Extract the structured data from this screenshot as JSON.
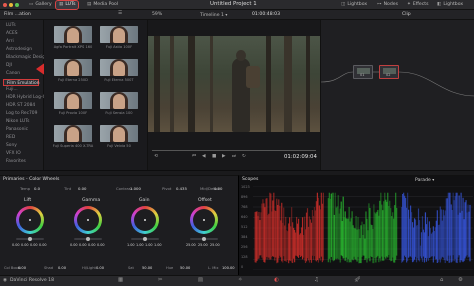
{
  "topbar": {
    "tabs": [
      {
        "label": "Gallery",
        "icon": "gallery-icon"
      },
      {
        "label": "LUTs",
        "icon": "luts-icon",
        "active": true
      },
      {
        "label": "Media Pool",
        "icon": "media-pool-icon"
      }
    ],
    "project_title": "Untitled Project 1",
    "right_tabs": [
      {
        "label": "Lightbox",
        "icon": "lightbox-icon"
      },
      {
        "label": "Nodes",
        "icon": "nodes-icon"
      },
      {
        "label": "Effects",
        "icon": "effects-icon"
      },
      {
        "label": "Lightbox",
        "icon": "lightbox-icon"
      }
    ]
  },
  "bar2": {
    "breadcrumb": "Film ...ation",
    "zoom": "59%",
    "timeline": "Timeline 1",
    "timecode": "01:00:48:03",
    "clip_label": "Clip"
  },
  "lut_tree": {
    "items": [
      "LUTs",
      "ACES",
      "Arri",
      "Astrodesign",
      "Blackmagic Design",
      "DJI",
      "Canon",
      "Film Emulation",
      "Fuji...",
      "HDR Hybrid Log-Gamma",
      "HDR ST 2084",
      "Log to Rec709",
      "Nikon LUTs",
      "Panasonic",
      "RED",
      "Sony",
      "VFX IO",
      "Favorites"
    ],
    "selected_index": 7
  },
  "lut_thumbs": [
    {
      "label": "Agfa Portrait XPS 160"
    },
    {
      "label": "Fuji Astia 100F"
    },
    {
      "label": "Fuji Eterna 250D"
    },
    {
      "label": "Fuji Eterna 500T"
    },
    {
      "label": "Fuji Provia 100F"
    },
    {
      "label": "Fuji Sensia 100"
    },
    {
      "label": "Fuji Superia 400 X-TRA"
    },
    {
      "label": "Fuji Velvia 50"
    }
  ],
  "viewer": {
    "timecode": "01:02:09:04"
  },
  "nodes": {
    "node_labels": [
      "01",
      "02"
    ]
  },
  "color_panel": {
    "title": "Primaries - Color Wheels",
    "top_params": [
      {
        "label": "Temp",
        "value": "0.0"
      },
      {
        "label": "Tint",
        "value": "0.00"
      },
      {
        "label": "Contrast",
        "value": "1.000"
      },
      {
        "label": "Pivot",
        "value": "0.435"
      },
      {
        "label": "Mid/Detail",
        "value": "0.00"
      }
    ],
    "wheels": [
      {
        "name": "Lift",
        "values": [
          "0.00",
          "0.00",
          "0.00",
          "0.00"
        ]
      },
      {
        "name": "Gamma",
        "values": [
          "0.00",
          "0.00",
          "0.00",
          "0.00"
        ]
      },
      {
        "name": "Gain",
        "values": [
          "1.00",
          "1.00",
          "1.00",
          "1.00"
        ]
      },
      {
        "name": "Offset",
        "values": [
          "25.00",
          "25.00",
          "25.00"
        ]
      }
    ],
    "bottom_params": [
      {
        "label": "Col Boost",
        "value": "0.00"
      },
      {
        "label": "Shad",
        "value": "0.00"
      },
      {
        "label": "Hi/Light",
        "value": "0.00"
      },
      {
        "label": "Sat",
        "value": "50.00"
      },
      {
        "label": "Hue",
        "value": "50.00"
      },
      {
        "label": "L. Mix",
        "value": "100.00"
      }
    ]
  },
  "scopes": {
    "title": "Scopes",
    "mode": "Parade",
    "scale": [
      "1023",
      "896",
      "768",
      "640",
      "512",
      "384",
      "256",
      "128",
      "0"
    ],
    "colors": {
      "red": "#e0312c",
      "green": "#2ccd33",
      "blue": "#3a5cf0"
    }
  },
  "bottom_bar": {
    "app_name": "DaVinci Resolve 18"
  },
  "accent_color": "#d23b3b"
}
